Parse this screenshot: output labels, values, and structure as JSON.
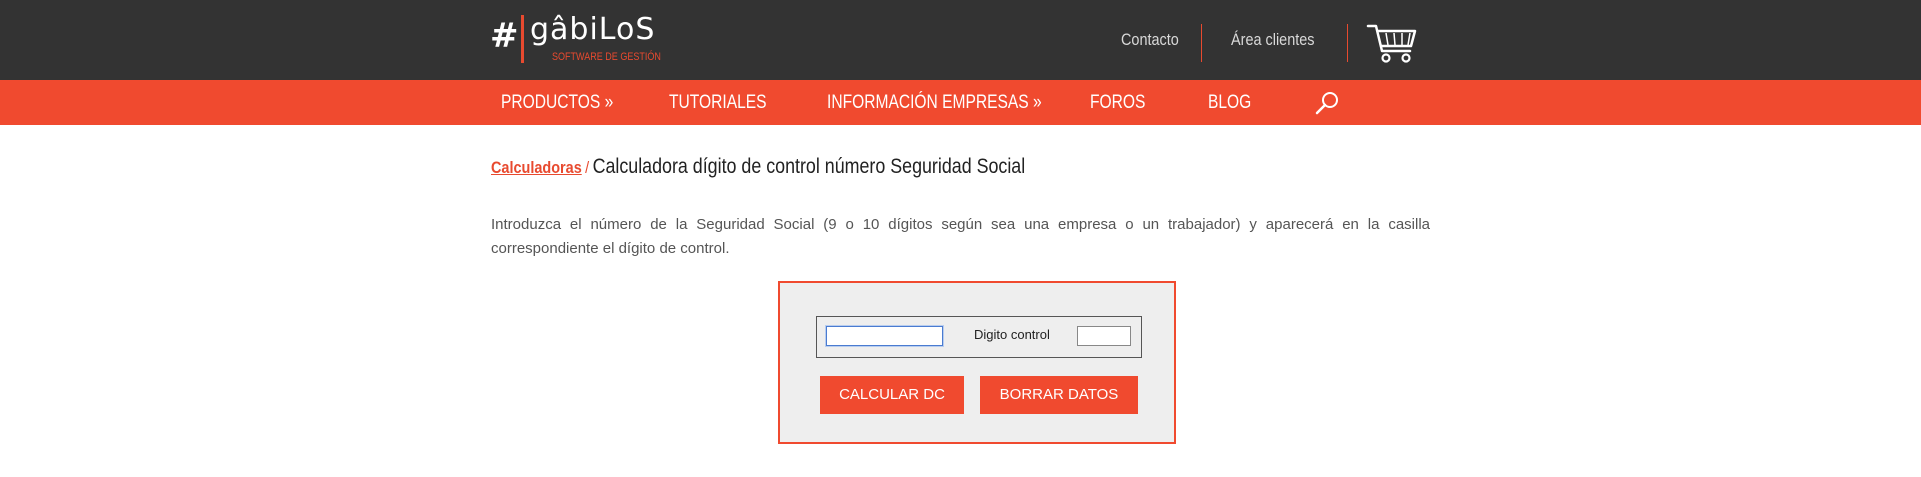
{
  "header": {
    "logo_name": "gâbiLoS",
    "logo_symbol": "#",
    "logo_tagline": "SOFTWARE DE GESTIÓN",
    "links": {
      "contact": "Contacto",
      "clients": "Área clientes"
    },
    "cart_icon": "shopping-cart-icon"
  },
  "nav": {
    "items": [
      "PRODUCTOS »",
      "TUTORIALES",
      "INFORMACIÓN EMPRESAS »",
      "FOROS",
      "BLOG"
    ],
    "search_icon": "search-icon"
  },
  "breadcrumb": {
    "parent": "Calculadoras",
    "separator": "/",
    "current": "Calculadora dígito de control número Seguridad Social"
  },
  "intro_text": "Introduzca el número de la Seguridad Social (9 o 10 dígitos según sea una empresa o un trabajador) y aparecerá en la casilla correspondiente el dígito de control.",
  "calculator": {
    "ss_number_value": "",
    "dc_label": "Digito control",
    "dc_value": "",
    "calculate_button": "CALCULAR DC",
    "clear_button": "BORRAR DATOS"
  },
  "colors": {
    "accent": "#f04a2f",
    "topbar": "#333333",
    "panel": "#eeeeee"
  }
}
